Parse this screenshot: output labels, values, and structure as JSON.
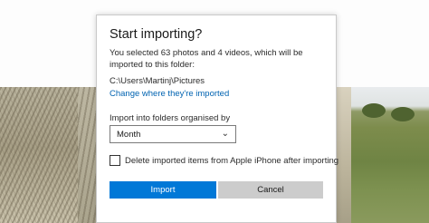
{
  "dialog": {
    "title": "Start importing?",
    "message": "You selected 63 photos and 4 videos, which will be imported to this folder:",
    "folder_path": "C:\\Users\\Martinj\\Pictures",
    "change_location_link": "Change where they're imported",
    "folders_label": "Import into folders organised by",
    "folders_select": {
      "value": "Month"
    },
    "delete_checkbox": {
      "label": "Delete imported items from Apple iPhone after importing",
      "checked": false
    },
    "import_button": "Import",
    "cancel_button": "Cancel"
  },
  "colors": {
    "accent": "#0078d7",
    "link": "#0063b1",
    "cancel_button": "#cccccc"
  }
}
